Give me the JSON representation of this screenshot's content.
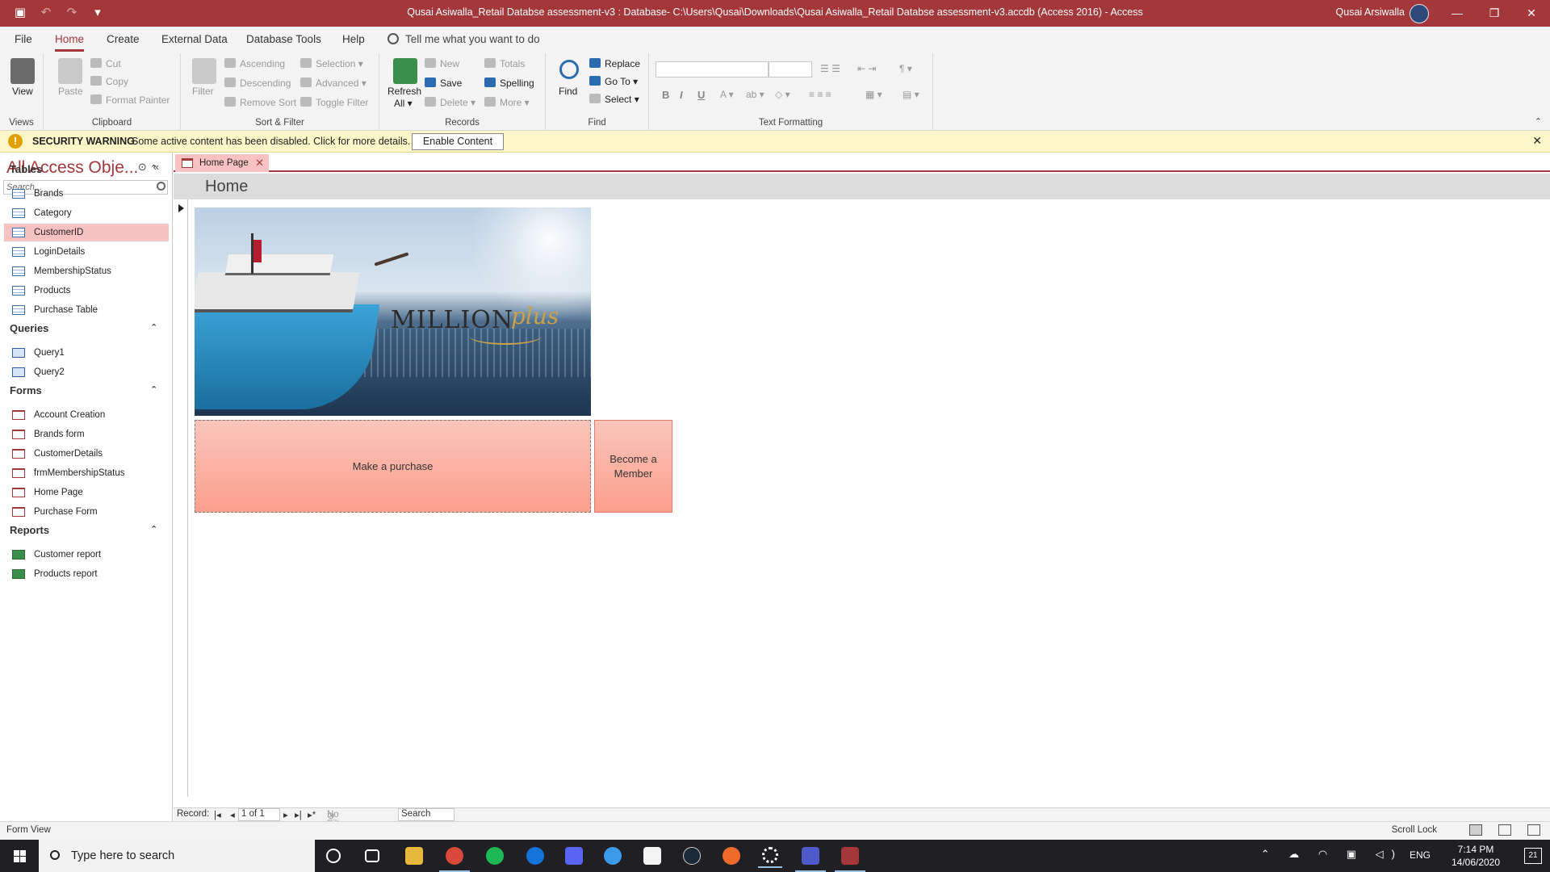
{
  "titlebar": {
    "title": "Qusai Asiwalla_Retail Databse assessment-v3 : Database- C:\\Users\\Qusai\\Downloads\\Qusai Asiwalla_Retail Databse assessment-v3.accdb (Access 2016)  -  Access",
    "user": "Qusai Arsiwalla",
    "minimize": "—",
    "restore": "❐",
    "close": "✕"
  },
  "ribbon_tabs": [
    "File",
    "Home",
    "Create",
    "External Data",
    "Database Tools",
    "Help"
  ],
  "tell_me": "Tell me what you want to do",
  "ribbon": {
    "views": {
      "label": "Views",
      "view": "View"
    },
    "clipboard": {
      "label": "Clipboard",
      "paste": "Paste",
      "cut": "Cut",
      "copy": "Copy",
      "format_painter": "Format Painter"
    },
    "sort_filter": {
      "label": "Sort & Filter",
      "filter": "Filter",
      "ascending": "Ascending",
      "descending": "Descending",
      "remove_sort": "Remove Sort",
      "selection": "Selection",
      "advanced": "Advanced",
      "toggle_filter": "Toggle Filter"
    },
    "records": {
      "label": "Records",
      "refresh": "Refresh",
      "refresh_sub": "All",
      "new": "New",
      "save": "Save",
      "delete": "Delete",
      "totals": "Totals",
      "spelling": "Spelling",
      "more": "More"
    },
    "find": {
      "label": "Find",
      "find": "Find",
      "replace": "Replace",
      "goto": "Go To",
      "select": "Select"
    },
    "text_formatting": {
      "label": "Text Formatting",
      "bold": "B",
      "italic": "I",
      "underline": "U"
    }
  },
  "security": {
    "title": "SECURITY WARNING",
    "message": "Some active content has been disabled. Click for more details.",
    "button": "Enable Content"
  },
  "navpane": {
    "title": "All Access Obje...",
    "search_placeholder": "Search...",
    "categories": [
      {
        "name": "Tables",
        "type": "table",
        "items": [
          "Brands",
          "Category",
          "CustomerID",
          "LoginDetails",
          "MembershipStatus",
          "Products",
          "Purchase Table"
        ]
      },
      {
        "name": "Queries",
        "type": "query",
        "items": [
          "Query1",
          "Query2"
        ]
      },
      {
        "name": "Forms",
        "type": "form",
        "items": [
          "Account Creation",
          "Brands form",
          "CustomerDetails",
          "frmMembershipStatus",
          "Home Page",
          "Purchase Form"
        ]
      },
      {
        "name": "Reports",
        "type": "report",
        "items": [
          "Customer report",
          "Products report"
        ]
      }
    ],
    "selected": "CustomerID"
  },
  "document": {
    "tab": "Home Page",
    "header": "Home",
    "logo_text": "MILLION",
    "logo_script": "plus",
    "buttons": {
      "purchase": "Make a purchase",
      "member": "Become a Member"
    }
  },
  "record_nav": {
    "label": "Record:",
    "position": "1 of 1",
    "filter": "No Filter",
    "search": "Search"
  },
  "statusbar": {
    "left": "Form View",
    "right": "Scroll Lock"
  },
  "taskbar": {
    "search": "Type here to search",
    "lang": "ENG",
    "time": "7:14 PM",
    "date": "14/06/2020",
    "notifications": "21"
  },
  "colors": {
    "accent": "#a4373a",
    "button_fill": "#fc9f8d",
    "selection": "#f9c2c2"
  }
}
